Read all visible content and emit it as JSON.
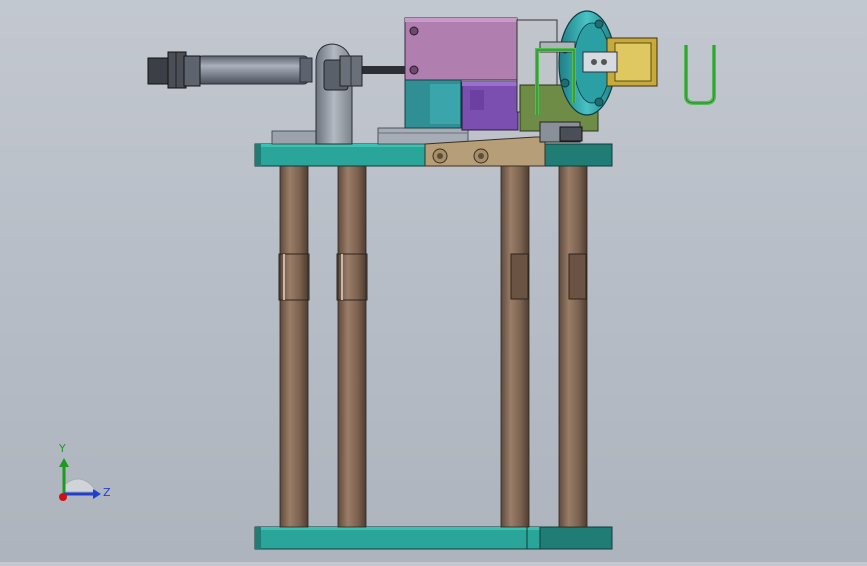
{
  "viewport": {
    "background": "#b9bfc8"
  },
  "triad": {
    "y_label": "Y",
    "z_label": "Z",
    "y_color": "#1e9a1e",
    "z_color": "#1f3fd0",
    "x_color": "#d01010"
  },
  "colors": {
    "teal_plate": "#2aa59a",
    "teal_dark": "#1f7d76",
    "column": "#7c6250",
    "column_light": "#9a7d68",
    "cylinder": "#707888",
    "bracket": "#9aa0a8",
    "pink_block": "#b07fb0",
    "purple_block": "#7a4fb0",
    "teal_block": "#2f8f95",
    "chuck": "#3ab0b5",
    "tan_plate": "#b59e78",
    "gripper": "#c8aa38",
    "wire": "#4fbf4f"
  }
}
